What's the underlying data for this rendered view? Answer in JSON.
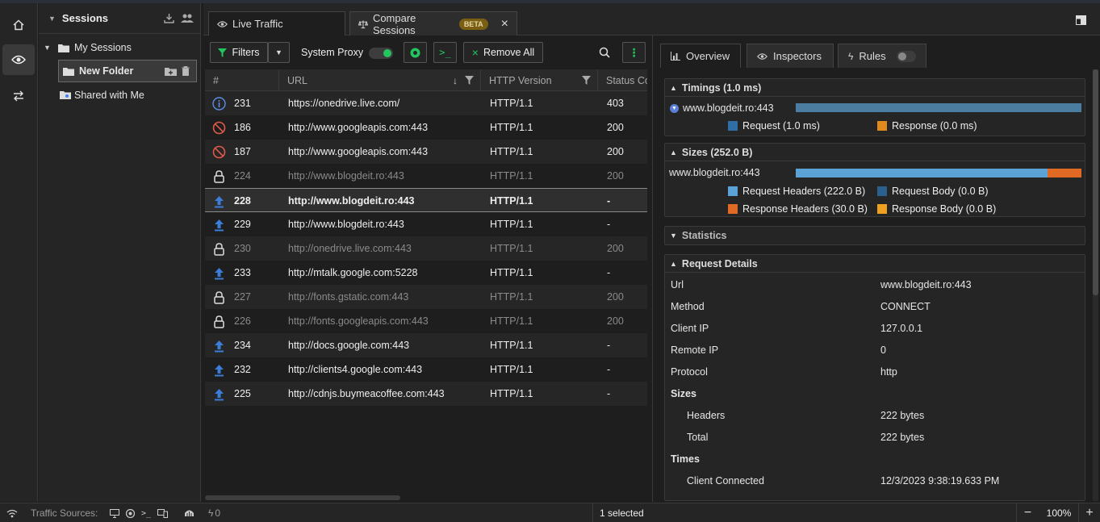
{
  "sessions": {
    "title": "Sessions",
    "items": [
      {
        "label": "My Sessions"
      },
      {
        "label": "New Folder"
      },
      {
        "label": "Shared with Me"
      }
    ]
  },
  "tabs": [
    {
      "label": "Live Traffic"
    },
    {
      "label": "Compare Sessions",
      "badge": "BETA"
    }
  ],
  "toolbar": {
    "filters_label": "Filters",
    "system_proxy_label": "System Proxy",
    "remove_all_label": "Remove All"
  },
  "grid": {
    "columns": [
      "#",
      "URL",
      "HTTP Version",
      "Status Co"
    ],
    "rows": [
      {
        "icon": "info",
        "id": "231",
        "url": "https://onedrive.live.com/",
        "version": "HTTP/1.1",
        "status": "403",
        "dim": false
      },
      {
        "icon": "blocked",
        "id": "186",
        "url": "http://www.googleapis.com:443",
        "version": "HTTP/1.1",
        "status": "200",
        "dim": false
      },
      {
        "icon": "blocked",
        "id": "187",
        "url": "http://www.googleapis.com:443",
        "version": "HTTP/1.1",
        "status": "200",
        "dim": false
      },
      {
        "icon": "lock",
        "id": "224",
        "url": "http://www.blogdeit.ro:443",
        "version": "HTTP/1.1",
        "status": "200",
        "dim": true
      },
      {
        "icon": "upload",
        "id": "228",
        "url": "http://www.blogdeit.ro:443",
        "version": "HTTP/1.1",
        "status": "-",
        "dim": false
      },
      {
        "icon": "upload",
        "id": "229",
        "url": "http://www.blogdeit.ro:443",
        "version": "HTTP/1.1",
        "status": "-",
        "dim": false
      },
      {
        "icon": "lock",
        "id": "230",
        "url": "http://onedrive.live.com:443",
        "version": "HTTP/1.1",
        "status": "200",
        "dim": true
      },
      {
        "icon": "upload",
        "id": "233",
        "url": "http://mtalk.google.com:5228",
        "version": "HTTP/1.1",
        "status": "-",
        "dim": false
      },
      {
        "icon": "lock",
        "id": "227",
        "url": "http://fonts.gstatic.com:443",
        "version": "HTTP/1.1",
        "status": "200",
        "dim": true
      },
      {
        "icon": "lock",
        "id": "226",
        "url": "http://fonts.googleapis.com:443",
        "version": "HTTP/1.1",
        "status": "200",
        "dim": true
      },
      {
        "icon": "upload",
        "id": "234",
        "url": "http://docs.google.com:443",
        "version": "HTTP/1.1",
        "status": "-",
        "dim": false
      },
      {
        "icon": "upload",
        "id": "232",
        "url": "http://clients4.google.com:443",
        "version": "HTTP/1.1",
        "status": "-",
        "dim": false
      },
      {
        "icon": "upload",
        "id": "225",
        "url": "http://cdnjs.buymeacoffee.com:443",
        "version": "HTTP/1.1",
        "status": "-",
        "dim": false
      }
    ],
    "selected_row": 4
  },
  "right_tabs": [
    {
      "label": "Overview"
    },
    {
      "label": "Inspectors"
    },
    {
      "label": "Rules"
    }
  ],
  "overview": {
    "timings": {
      "title": "Timings (1.0 ms)",
      "host": "www.blogdeit.ro:443",
      "request_fraction": 1.0,
      "legend_request": "Request (1.0 ms)",
      "legend_response": "Response (0.0 ms)"
    },
    "sizes": {
      "title": "Sizes (252.0 B)",
      "host": "www.blogdeit.ro:443",
      "request_headers_fraction": 0.881,
      "response_headers_fraction": 0.119,
      "legend": [
        "Request Headers (222.0 B)",
        "Request Body (0.0 B)",
        "Response Headers (30.0 B)",
        "Response Body (0.0 B)"
      ]
    },
    "statistics_title": "Statistics",
    "details": {
      "title": "Request Details",
      "rows": [
        {
          "key": "Url",
          "value": "www.blogdeit.ro:443",
          "style": "plain"
        },
        {
          "key": "Method",
          "value": "CONNECT",
          "style": "plain"
        },
        {
          "key": "Client IP",
          "value": "127.0.0.1",
          "style": "plain"
        },
        {
          "key": "Remote IP",
          "value": "0",
          "style": "plain"
        },
        {
          "key": "Protocol",
          "value": "http",
          "style": "plain"
        },
        {
          "key": "Sizes",
          "value": "",
          "style": "bold"
        },
        {
          "key": "Headers",
          "value": "222 bytes",
          "style": "indent"
        },
        {
          "key": "Total",
          "value": "222 bytes",
          "style": "indent"
        },
        {
          "key": "Times",
          "value": "",
          "style": "bold"
        },
        {
          "key": "Client Connected",
          "value": "12/3/2023 9:38:19.633 PM",
          "style": "indent"
        }
      ]
    }
  },
  "colors": {
    "timing_bar": "#4a7da0",
    "request": "#2f6fa5",
    "response": "#e08a1e",
    "req_headers": "#5ba3d6",
    "req_body": "#2a5f8e",
    "resp_headers": "#e06a23",
    "resp_body": "#f0a021"
  },
  "status": {
    "traffic_sources_label": "Traffic Sources:",
    "zero": "0",
    "selected": "1 selected",
    "zoom": "100%"
  }
}
